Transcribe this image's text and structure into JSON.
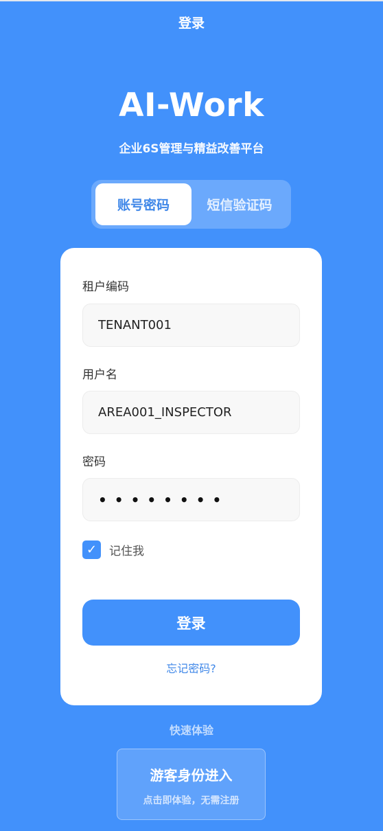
{
  "header": {
    "title": "登录"
  },
  "brand": {
    "name": "AI-Work",
    "tagline": "企业6S管理与精益改善平台"
  },
  "tabs": [
    {
      "label": "账号密码",
      "active": true
    },
    {
      "label": "短信验证码",
      "active": false
    }
  ],
  "form": {
    "tenant": {
      "label": "租户编码",
      "value": "TENANT001"
    },
    "username": {
      "label": "用户名",
      "value": "AREA001_INSPECTOR"
    },
    "password": {
      "label": "密码",
      "masked": "••••••••"
    },
    "remember": {
      "label": "记住我",
      "checked": true,
      "check_glyph": "✓"
    },
    "submit_label": "登录",
    "forgot_label": "忘记密码?"
  },
  "quick": {
    "label": "快速体验",
    "guest_title": "游客身份进入",
    "guest_subtitle": "点击即体验，无需注册"
  },
  "colors": {
    "primary": "#4291fb",
    "card": "#ffffff",
    "link": "#3f87e8"
  }
}
